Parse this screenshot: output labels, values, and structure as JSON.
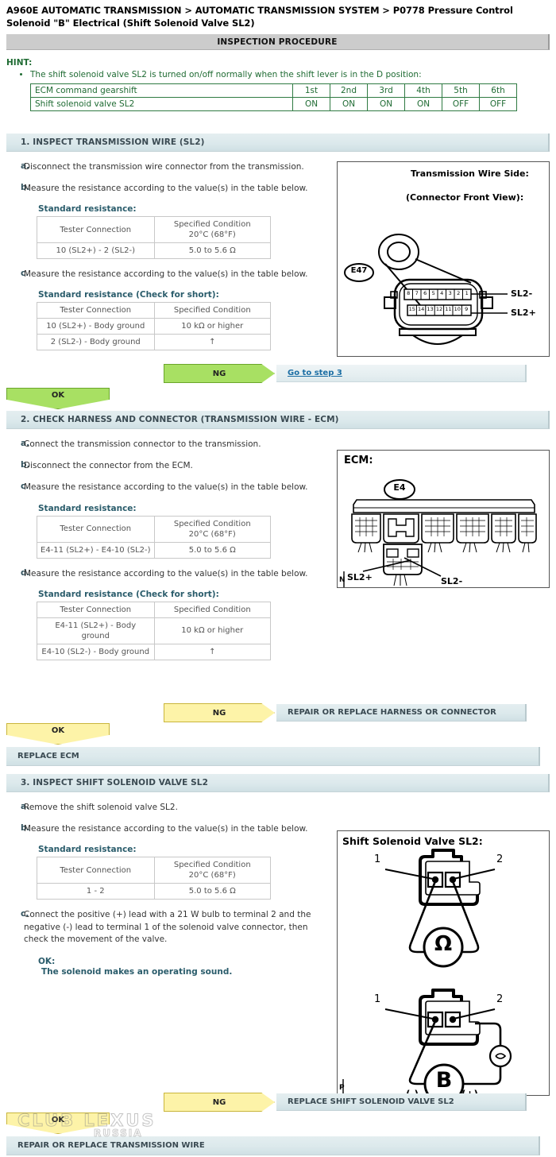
{
  "header": {
    "breadcrumb": "A960E AUTOMATIC TRANSMISSION > AUTOMATIC TRANSMISSION SYSTEM > P0778 Pressure Control Solenoid \"B\" Electrical (Shift Solenoid Valve SL2)",
    "procedure_bar": "INSPECTION PROCEDURE"
  },
  "hint": {
    "label": "HINT:",
    "bullet": "The shift solenoid valve SL2 is turned on/off normally when the shift lever is in the D position:",
    "table": {
      "rows": [
        {
          "label": "ECM command gearshift",
          "values": [
            "1st",
            "2nd",
            "3rd",
            "4th",
            "5th",
            "6th"
          ]
        },
        {
          "label": "Shift solenoid valve SL2",
          "values": [
            "ON",
            "ON",
            "ON",
            "ON",
            "OFF",
            "OFF"
          ]
        }
      ]
    }
  },
  "step1": {
    "title": "1. INSPECT TRANSMISSION WIRE (SL2)",
    "a_letter": "a.",
    "a_text": "Disconnect the transmission wire connector from the transmission.",
    "b_letter": "b.",
    "b_text": "Measure the resistance according to the value(s) in the table below.",
    "std_title": "Standard resistance:",
    "table1": {
      "h1": "Tester Connection",
      "h2": "Specified Condition\n20°C (68°F)",
      "h2_line1": "Specified Condition",
      "h2_line2": "20°C (68°F)",
      "r1c1": "10 (SL2+) - 2 (SL2-)",
      "r1c2": "5.0 to 5.6 Ω"
    },
    "c_letter": "c.",
    "c_text": "Measure the resistance according to the value(s) in the table below.",
    "short_title": "Standard resistance (Check for short):",
    "table2": {
      "h1": "Tester Connection",
      "h2": "Specified Condition",
      "r1c1": "10 (SL2+) - Body ground",
      "r1c2": "10 kΩ or higher",
      "r2c1": "2 (SL2-) - Body ground",
      "r2c2": "↑"
    },
    "figure": {
      "title_line1": "Transmission Wire Side:",
      "title_line2": "(Connector Front View):",
      "connector_id": "E47",
      "pins_top": [
        "8",
        "7",
        "6",
        "5",
        "4",
        "3",
        "2",
        "1"
      ],
      "pins_bottom": [
        "15",
        "14",
        "13",
        "12",
        "11",
        "10",
        "9"
      ],
      "label_top": "SL2-",
      "label_bottom": "SL2+"
    },
    "ng": "NG",
    "ng_result": "Go to step 3",
    "ok": "OK"
  },
  "step2": {
    "title": "2. CHECK HARNESS AND CONNECTOR (TRANSMISSION WIRE - ECM)",
    "a_letter": "a.",
    "a_text": "Connect the transmission connector to the transmission.",
    "b_letter": "b.",
    "b_text": "Disconnect the connector from the ECM.",
    "c_letter": "c.",
    "c_text": "Measure the resistance according to the value(s) in the table below.",
    "std_title": "Standard resistance:",
    "table1": {
      "h1": "Tester Connection",
      "h2_line1": "Specified Condition",
      "h2_line2": "20°C (68°F)",
      "r1c1": "E4-11 (SL2+) - E4-10 (SL2-)",
      "r1c2": "5.0 to 5.6 Ω"
    },
    "d_letter": "d.",
    "d_text": "Measure the resistance according to the value(s) in the table below.",
    "short_title": "Standard resistance (Check for short):",
    "table2": {
      "h1": "Tester Connection",
      "h2": "Specified Condition",
      "r1c1": "E4-11 (SL2+) - Body ground",
      "r1c2": "10 kΩ or higher",
      "r2c1": "E4-10 (SL2-) - Body ground",
      "r2c2": "↑"
    },
    "figure": {
      "title": "ECM:",
      "connector_id": "E4",
      "label_left": "SL2+",
      "label_right": "SL2-",
      "corner_mark": "N"
    },
    "ng": "NG",
    "ng_result": "REPAIR OR REPLACE HARNESS OR CONNECTOR",
    "ok": "OK",
    "ok_result": "REPLACE ECM"
  },
  "step3": {
    "title": "3. INSPECT SHIFT SOLENOID VALVE SL2",
    "a_letter": "a.",
    "a_text": "Remove the shift solenoid valve SL2.",
    "b_letter": "b.",
    "b_text": "Measure the resistance according to the value(s) in the table below.",
    "std_title": "Standard resistance:",
    "table1": {
      "h1": "Tester Connection",
      "h2_line1": "Specified Condition",
      "h2_line2": "20°C (68°F)",
      "r1c1": "1 - 2",
      "r1c2": "5.0 to 5.6 Ω"
    },
    "c_letter": "c.",
    "c_text": "Connect the positive (+) lead with a 21 W bulb to terminal 2 and the negative (-) lead to terminal 1 of the solenoid valve connector, then check the movement of the valve.",
    "ok_label": "OK:",
    "ok_text": "The solenoid makes an operating sound.",
    "figure": {
      "title": "Shift Solenoid Valve SL2:",
      "pin_left": "1",
      "pin_right": "2",
      "ohm_symbol": "Ω",
      "battery_symbol": "B",
      "neg": "(-)",
      "pos": "(+)",
      "corner_mark": "P"
    },
    "ng": "NG",
    "ng_result": "REPLACE SHIFT SOLENOID VALVE SL2",
    "ok": "OK",
    "ok_result": "REPAIR OR REPLACE TRANSMISSION WIRE"
  },
  "watermark": {
    "main": "CLUB LEXUS",
    "sub": "RUSSIA"
  }
}
